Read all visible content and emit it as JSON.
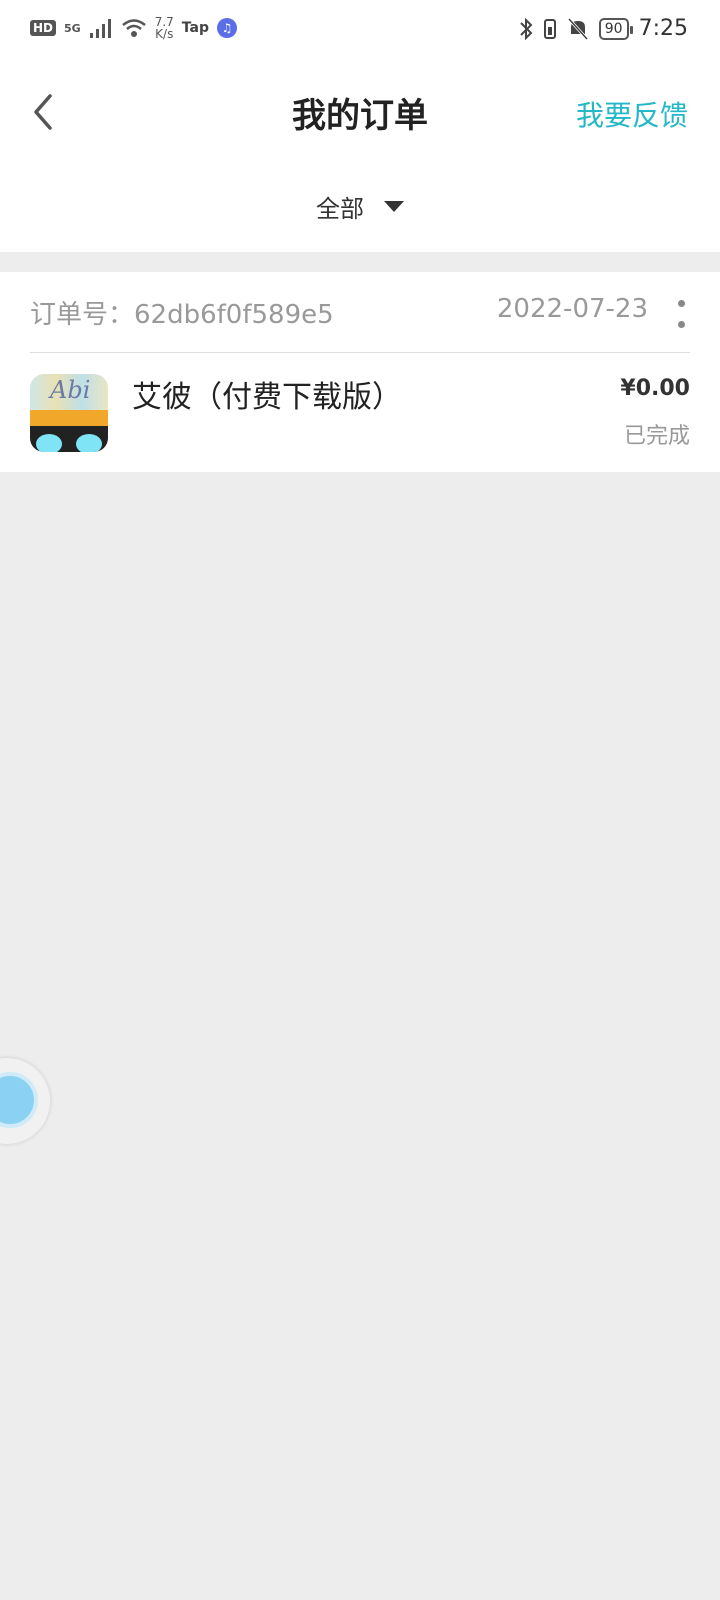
{
  "status_bar": {
    "hd": "HD",
    "signal": "5G",
    "net_speed_value": "7.7",
    "net_speed_unit": "K/s",
    "tap_label": "Tap",
    "battery": "90",
    "time": "7:25",
    "icons": [
      "signal-icon",
      "wifi-icon",
      "music-icon",
      "bluetooth-icon",
      "vibrate-icon",
      "mute-icon",
      "battery-icon"
    ]
  },
  "nav": {
    "title": "我的订单",
    "feedback": "我要反馈",
    "back_icon": "chevron-left-icon"
  },
  "filter": {
    "label": "全部"
  },
  "order": {
    "number": "订单号：62db6f0f589e5",
    "date": "2022-07-23",
    "app_name": "艾彼（付费下载版）",
    "icon_text": "Abi",
    "price": "¥0.00",
    "status": "已完成"
  },
  "colors": {
    "accent": "#23b7c7",
    "background": "#ededed"
  }
}
